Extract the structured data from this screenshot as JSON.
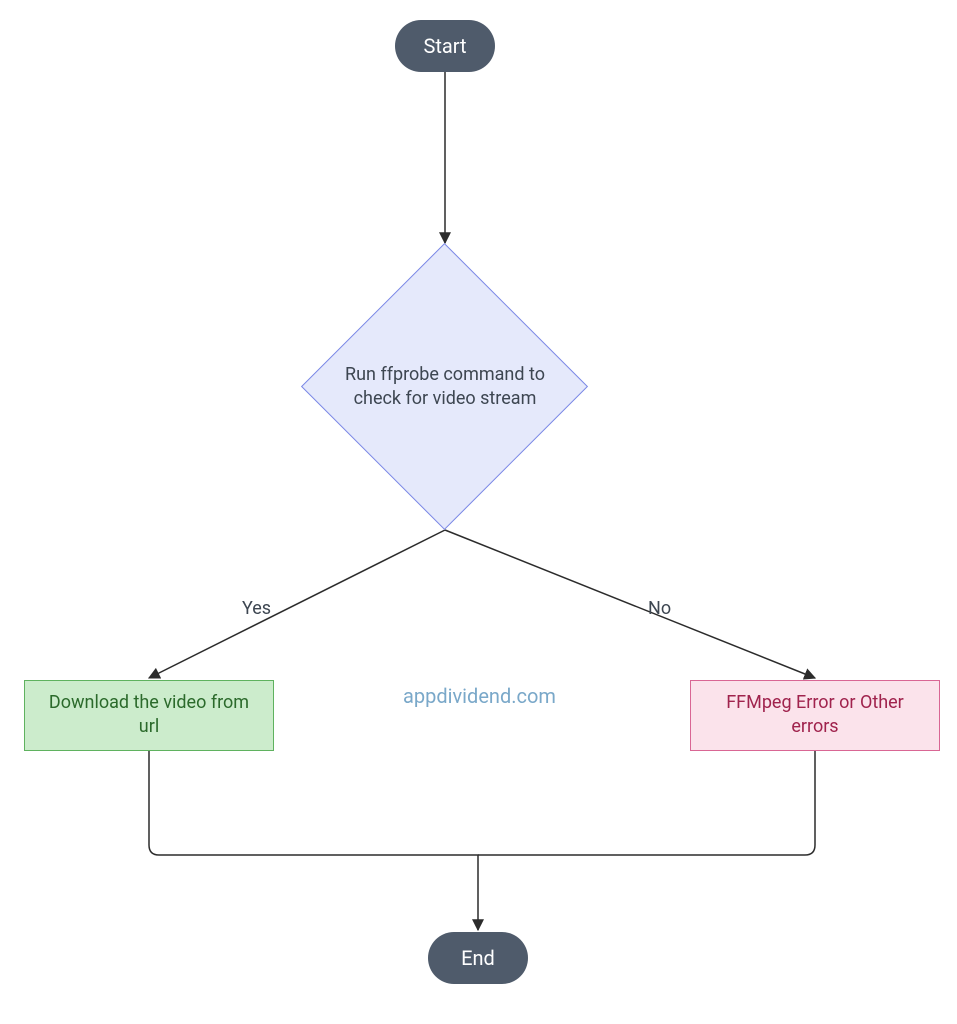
{
  "chart_data": {
    "type": "flowchart",
    "nodes": [
      {
        "id": "start",
        "kind": "terminator",
        "label": "Start"
      },
      {
        "id": "decision",
        "kind": "decision",
        "label": "Run ffprobe command to check for video stream"
      },
      {
        "id": "download",
        "kind": "process",
        "label": "Download the video from url"
      },
      {
        "id": "error",
        "kind": "process",
        "label": "FFMpeg Error or Other errors"
      },
      {
        "id": "end",
        "kind": "terminator",
        "label": "End"
      }
    ],
    "edges": [
      {
        "from": "start",
        "to": "decision",
        "label": ""
      },
      {
        "from": "decision",
        "to": "download",
        "label": "Yes"
      },
      {
        "from": "decision",
        "to": "error",
        "label": "No"
      },
      {
        "from": "download",
        "to": "end",
        "label": ""
      },
      {
        "from": "error",
        "to": "end",
        "label": ""
      }
    ]
  },
  "nodes": {
    "start": "Start",
    "decision": "Run ffprobe command to check for video stream",
    "download": "Download the video from url",
    "error": "FFMpeg Error or Other errors",
    "end": "End"
  },
  "edge_labels": {
    "yes": "Yes",
    "no": "No"
  },
  "watermark": "appdividend.com",
  "colors": {
    "terminator_bg": "#4f5b6b",
    "terminator_fg": "#ffffff",
    "decision_bg": "#e5e9fb",
    "decision_border": "#7a87e6",
    "process_success_bg": "#cceccc",
    "process_success_border": "#5fb25f",
    "process_error_bg": "#fbe3eb",
    "process_error_border": "#d96694",
    "watermark": "#7aa8c9"
  }
}
